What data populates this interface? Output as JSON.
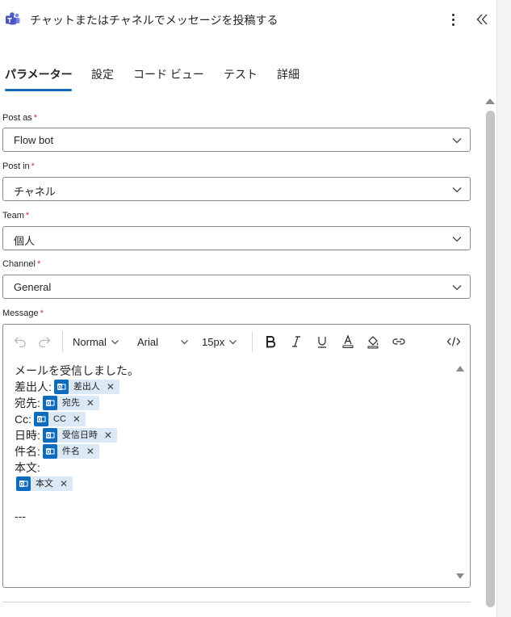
{
  "header": {
    "title": "チャットまたはチャネルでメッセージを投稿する",
    "app_icon": "teams-icon",
    "more_icon": "more-vertical-icon",
    "collapse_icon": "double-chevron-left-icon"
  },
  "tabs": [
    {
      "label": "パラメーター",
      "active": true
    },
    {
      "label": "設定",
      "active": false
    },
    {
      "label": "コード ビュー",
      "active": false
    },
    {
      "label": "テスト",
      "active": false
    },
    {
      "label": "詳細",
      "active": false
    }
  ],
  "fields": {
    "post_as": {
      "label": "Post as",
      "required": "*",
      "value": "Flow bot"
    },
    "post_in": {
      "label": "Post in",
      "required": "*",
      "value": "チャネル"
    },
    "team": {
      "label": "Team",
      "required": "*",
      "value": "個人"
    },
    "channel": {
      "label": "Channel",
      "required": "*",
      "value": "General"
    },
    "message": {
      "label": "Message",
      "required": "*"
    }
  },
  "toolbar": {
    "style": "Normal",
    "font": "Arial",
    "size": "15px"
  },
  "message": {
    "line1": "メールを受信しました。",
    "from_label": "差出人:",
    "from_token": "差出人",
    "to_label": "宛先:",
    "to_token": "宛先",
    "cc_label": "Cc:",
    "cc_token": "CC",
    "date_label": "日時:",
    "date_token": "受信日時",
    "subject_label": "件名:",
    "subject_token": "件名",
    "body_label": "本文:",
    "body_token": "本文",
    "separator": "---",
    "remove_glyph": "✕"
  },
  "colors": {
    "accent": "#0f6cbd",
    "required": "#c4314b",
    "token_bg": "#dbe9f7"
  }
}
